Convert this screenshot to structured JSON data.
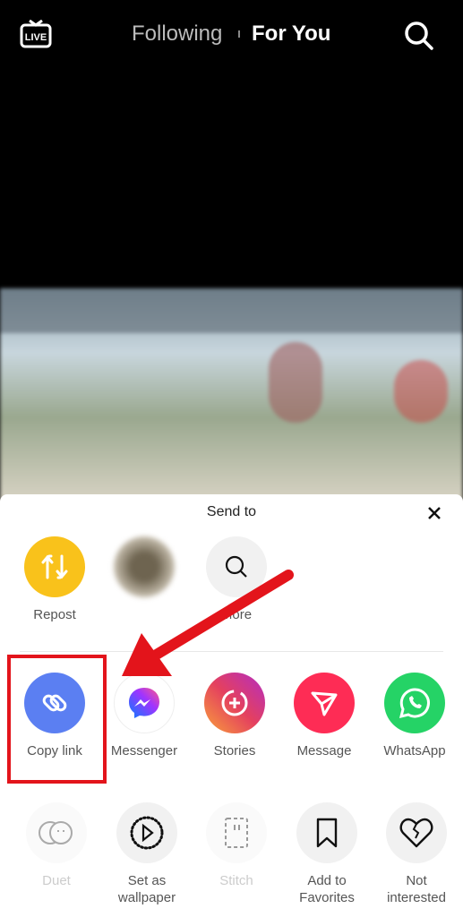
{
  "topbar": {
    "live_label": "LIVE",
    "tabs": [
      {
        "label": "Following",
        "active": false
      },
      {
        "label": "For You",
        "active": true
      }
    ]
  },
  "sheet": {
    "title": "Send to",
    "row1": [
      {
        "label": "Repost",
        "icon": "repost-icon",
        "color": "#f9c21b"
      },
      {
        "label": "",
        "icon": "contact-avatar",
        "color": "#8a7a60"
      },
      {
        "label": "More",
        "icon": "search-icon",
        "color": "#f1f1f1"
      }
    ],
    "row2": [
      {
        "label": "Copy link",
        "icon": "link-icon",
        "color": "#5b7ff2"
      },
      {
        "label": "Messenger",
        "icon": "messenger-icon",
        "color": "#ffffff"
      },
      {
        "label": "Stories",
        "icon": "stories-icon",
        "color": "#e4405f"
      },
      {
        "label": "Message",
        "icon": "send-icon",
        "color": "#fe2c55"
      },
      {
        "label": "WhatsApp",
        "icon": "whatsapp-icon",
        "color": "#25d366"
      }
    ],
    "row3": [
      {
        "label": "Duet",
        "icon": "duet-icon",
        "disabled": true
      },
      {
        "label": "Set as wallpaper",
        "icon": "wallpaper-play-icon",
        "disabled": false
      },
      {
        "label": "Stitch",
        "icon": "stitch-icon",
        "disabled": true
      },
      {
        "label": "Add to Favorites",
        "icon": "bookmark-icon",
        "disabled": false
      },
      {
        "label": "Not interested",
        "icon": "broken-heart-icon",
        "disabled": false
      }
    ]
  },
  "annotation": {
    "highlight_color": "#e3141b"
  }
}
